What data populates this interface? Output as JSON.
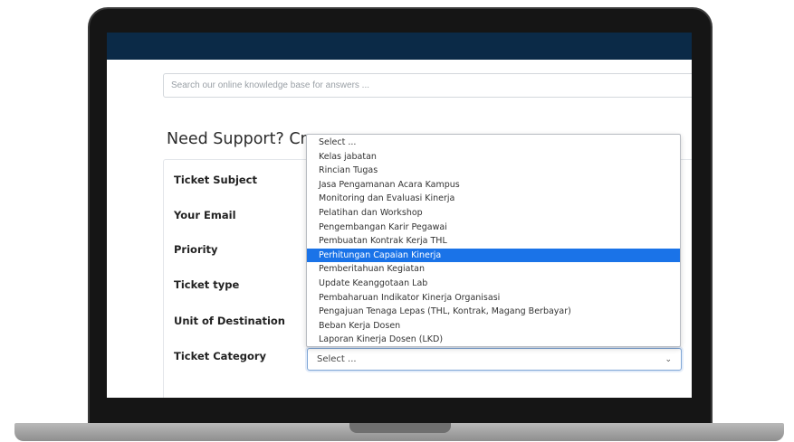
{
  "search": {
    "placeholder": "Search our online knowledge base for answers ..."
  },
  "form": {
    "title": "Need Support? Create Ticket",
    "labels": {
      "subject": "Ticket Subject",
      "email": "Your Email",
      "priority": "Priority",
      "type": "Ticket type",
      "unit": "Unit of Destination",
      "category": "Ticket Category"
    }
  },
  "category_select": {
    "value": "Select ...",
    "options": [
      "Select ...",
      "Kelas jabatan",
      "Rincian Tugas",
      "Jasa Pengamanan Acara Kampus",
      "Monitoring dan Evaluasi Kinerja",
      "Pelatihan dan Workshop",
      "Pengembangan Karir Pegawai",
      "Pembuatan Kontrak Kerja THL",
      "Perhitungan Capaian Kinerja",
      "Pemberitahuan Kegiatan",
      "Update Keanggotaan Lab",
      "Pembaharuan Indikator Kinerja Organisasi",
      "Pengajuan Tenaga Lepas (THL, Kontrak, Magang Berbayar)",
      "Beban Kerja Dosen",
      "Laporan Kinerja Dosen (LKD)"
    ],
    "highlighted": "Perhitungan Capaian Kinerja"
  },
  "icons": {
    "select_arrow": "chevron-down-icon"
  },
  "colors": {
    "topbar": "#0b2a47",
    "highlight": "#1a73e8"
  }
}
